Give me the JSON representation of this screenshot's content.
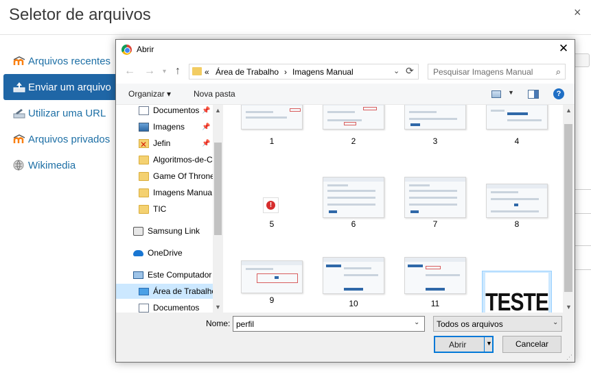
{
  "file_picker": {
    "title": "Seletor de arquivos",
    "close_glyph": "×",
    "nav": [
      {
        "label": "Arquivos recentes",
        "icon": "moodle-icon",
        "active": false
      },
      {
        "label": "Enviar um arquivo",
        "icon": "upload-icon",
        "active": true
      },
      {
        "label": "Utilizar uma URL",
        "icon": "url-icon",
        "active": false
      },
      {
        "label": "Arquivos privados",
        "icon": "moodle-icon",
        "active": false
      },
      {
        "label": "Wikimedia",
        "icon": "wikimedia-icon",
        "active": false
      }
    ]
  },
  "dialog": {
    "title": "Abrir",
    "close_glyph": "✕",
    "address": {
      "prefix": "«",
      "segments": [
        "Área de Trabalho",
        "Imagens Manual"
      ],
      "separator": "›"
    },
    "search_placeholder": "Pesquisar Imagens Manual",
    "toolbar": {
      "organize": "Organizar ▾",
      "new_folder": "Nova pasta",
      "help": "?"
    },
    "tree": [
      {
        "label": "Documentos",
        "icon": "documents-icon",
        "pinned": true,
        "selected": false
      },
      {
        "label": "Imagens",
        "icon": "pictures-icon",
        "pinned": true,
        "selected": false
      },
      {
        "label": "Jefin",
        "icon": "jefin-folder-icon",
        "pinned": true,
        "selected": false
      },
      {
        "label": "Algoritmos-de-C",
        "icon": "folder-icon",
        "pinned": false,
        "selected": false
      },
      {
        "label": "Game Of Throne",
        "icon": "folder-icon",
        "pinned": false,
        "selected": false
      },
      {
        "label": "Imagens Manua",
        "icon": "folder-icon",
        "pinned": false,
        "selected": false
      },
      {
        "label": "TIC",
        "icon": "folder-icon",
        "pinned": false,
        "selected": false
      },
      {
        "label": "Samsung Link",
        "icon": "samsung-link-icon",
        "pinned": false,
        "selected": false
      },
      {
        "label": "OneDrive",
        "icon": "onedrive-icon",
        "pinned": false,
        "selected": false
      },
      {
        "label": "Este Computador",
        "icon": "computer-icon",
        "pinned": false,
        "selected": false
      },
      {
        "label": "Área de Trabalho",
        "icon": "desktop-icon",
        "pinned": false,
        "selected": true
      },
      {
        "label": "Documentos",
        "icon": "documents-icon",
        "pinned": false,
        "selected": false
      }
    ],
    "files": [
      {
        "name": "1",
        "kind": "screenshot"
      },
      {
        "name": "2",
        "kind": "screenshot"
      },
      {
        "name": "3",
        "kind": "screenshot"
      },
      {
        "name": "4",
        "kind": "screenshot"
      },
      {
        "name": "5",
        "kind": "error"
      },
      {
        "name": "6",
        "kind": "screenshot"
      },
      {
        "name": "7",
        "kind": "screenshot"
      },
      {
        "name": "8",
        "kind": "screenshot"
      },
      {
        "name": "9",
        "kind": "screenshot"
      },
      {
        "name": "10",
        "kind": "screenshot"
      },
      {
        "name": "11",
        "kind": "screenshot"
      },
      {
        "name": "perfil",
        "kind": "image",
        "image_text": "TESTE",
        "selected": true
      }
    ],
    "bottom": {
      "name_label": "Nome:",
      "name_value": "perfil",
      "file_type": "Todos os arquivos",
      "open_button": "Abrir",
      "cancel_button": "Cancelar"
    }
  },
  "colors": {
    "accent": "#1f66a6",
    "link": "#1d6fa5",
    "selection": "#cce8ff",
    "focus_border": "#0078d7"
  }
}
